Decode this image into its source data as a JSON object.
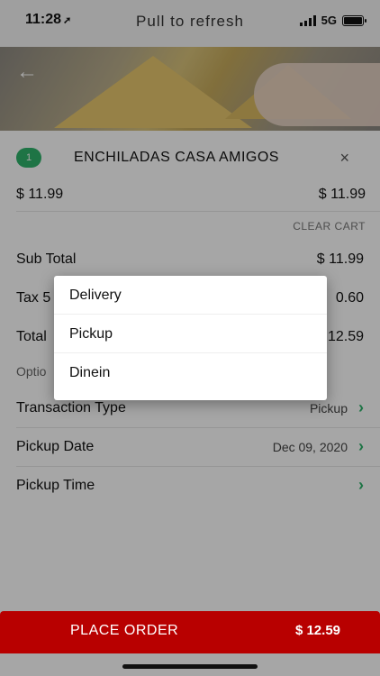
{
  "status_bar": {
    "time": "11:28",
    "location_glyph": "➚",
    "title": "Pull to refresh",
    "network": "5G"
  },
  "hero": {
    "back_icon": "←"
  },
  "cart": {
    "quantity": "1",
    "item_name": "ENCHILADAS CASA AMIGOS",
    "remove_icon": "×",
    "unit_price": "$ 11.99",
    "line_total": "$ 11.99",
    "clear_cart_label": "CLEAR CART"
  },
  "summary": {
    "subtotal_label": "Sub Total",
    "subtotal_value": "$ 11.99",
    "tax_label": "Tax 5",
    "tax_value": "0.60",
    "total_label": "Total",
    "total_value": "12.59"
  },
  "options": {
    "header": "Optio",
    "transaction_label": "Transaction Type",
    "transaction_value": "Pickup",
    "date_label": "Pickup Date",
    "date_value": "Dec 09, 2020",
    "time_label": "Pickup Time",
    "time_value": "",
    "chevron": "›"
  },
  "popup": {
    "options": [
      "Delivery",
      "Pickup",
      "Dinein"
    ]
  },
  "order_bar": {
    "label": "PLACE ORDER",
    "total": "$ 12.59"
  },
  "colors": {
    "accent_green": "#2fb26b",
    "order_red": "#b80000"
  }
}
